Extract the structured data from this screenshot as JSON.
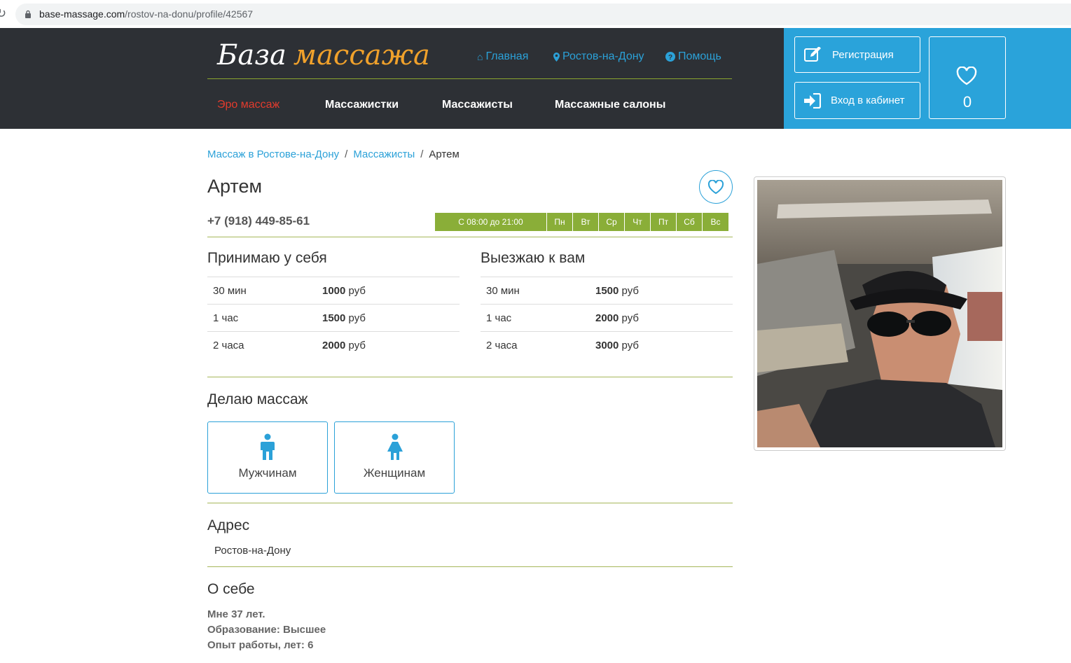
{
  "browser": {
    "url_host": "base-massage.com",
    "url_path": "/rostov-na-donu/profile/42567"
  },
  "header": {
    "logo_part1": "База",
    "logo_part2": "массажа",
    "nav": {
      "home": "Главная",
      "city": "Ростов-на-Дону",
      "help": "Помощь"
    },
    "menu": {
      "ero": "Эро массаж",
      "female": "Массажистки",
      "male": "Массажисты",
      "salons": "Массажные салоны"
    },
    "register_label": "Регистрация",
    "login_label": "Вход в кабинет",
    "favorites_count": "0"
  },
  "breadcrumbs": {
    "home": "Массаж в Ростове-на-Дону",
    "section": "Массажисты",
    "current": "Артем"
  },
  "profile": {
    "name": "Артем",
    "phone": "+7 (918) 449-85-61",
    "schedule": {
      "hours": "С 08:00 до 21:00",
      "days": [
        "Пн",
        "Вт",
        "Ср",
        "Чт",
        "Пт",
        "Сб",
        "Вс"
      ]
    },
    "incall": {
      "title": "Принимаю у себя",
      "rows": [
        {
          "time": "30 мин",
          "price": "1000",
          "unit": "руб"
        },
        {
          "time": "1 час",
          "price": "1500",
          "unit": "руб"
        },
        {
          "time": "2 часа",
          "price": "2000",
          "unit": "руб"
        }
      ]
    },
    "outcall": {
      "title": "Выезжаю к вам",
      "rows": [
        {
          "time": "30 мин",
          "price": "1500",
          "unit": "руб"
        },
        {
          "time": "1 час",
          "price": "2000",
          "unit": "руб"
        },
        {
          "time": "2 часа",
          "price": "3000",
          "unit": "руб"
        }
      ]
    },
    "massage_for": {
      "title": "Делаю массаж",
      "men": "Мужчинам",
      "women": "Женщинам"
    },
    "address": {
      "title": "Адрес",
      "value": "Ростов-на-Дону"
    },
    "about": {
      "title": "О себе",
      "lines": [
        "Мне 37 лет.",
        "Образование: Высшее",
        "Опыт работы, лет: 6"
      ]
    }
  },
  "colors": {
    "header_bg": "#2d3035",
    "accent_blue": "#2aa3da",
    "logo_orange": "#f0a12b",
    "schedule_green": "#8aae38",
    "ero_red": "#e23b2d"
  }
}
